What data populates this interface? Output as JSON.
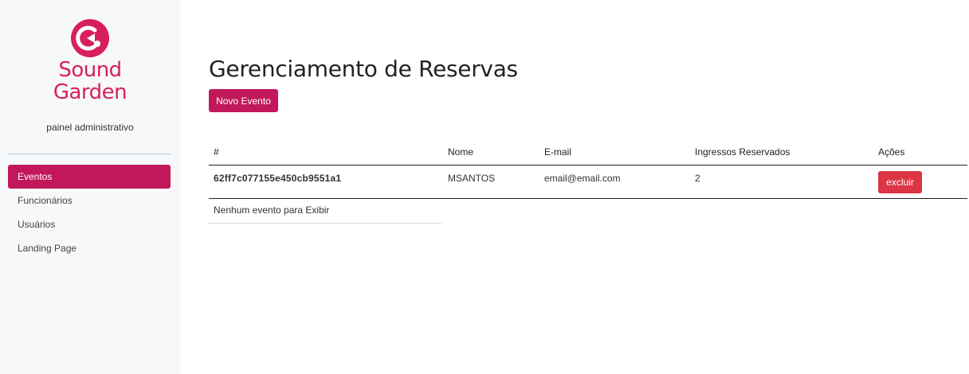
{
  "brand": {
    "name_line1": "Sound",
    "name_line2": "Garden",
    "subtitle": "painel administrativo",
    "color": "#d81f5e",
    "icon": "sound-garden-logo-icon"
  },
  "sidebar": {
    "items": [
      {
        "label": "Eventos",
        "active": true
      },
      {
        "label": "Funcionários",
        "active": false
      },
      {
        "label": "Usuários",
        "active": false
      },
      {
        "label": "Landing Page",
        "active": false
      }
    ]
  },
  "main": {
    "title": "Gerenciamento de Reservas",
    "new_button": "Novo Evento",
    "table": {
      "headers": [
        "#",
        "Nome",
        "E-mail",
        "Ingressos Reservados",
        "Ações"
      ],
      "rows": [
        {
          "id": "62ff7c077155e450cb9551a1",
          "nome": "MSANTOS",
          "email": "email@email.com",
          "ingressos": "2",
          "action": "excluir"
        }
      ]
    },
    "empty_message": "Nenhum evento para Exibir"
  },
  "colors": {
    "primary": "#c2185b",
    "danger": "#dc3545",
    "sidebar_bg": "#f7f8fa"
  }
}
